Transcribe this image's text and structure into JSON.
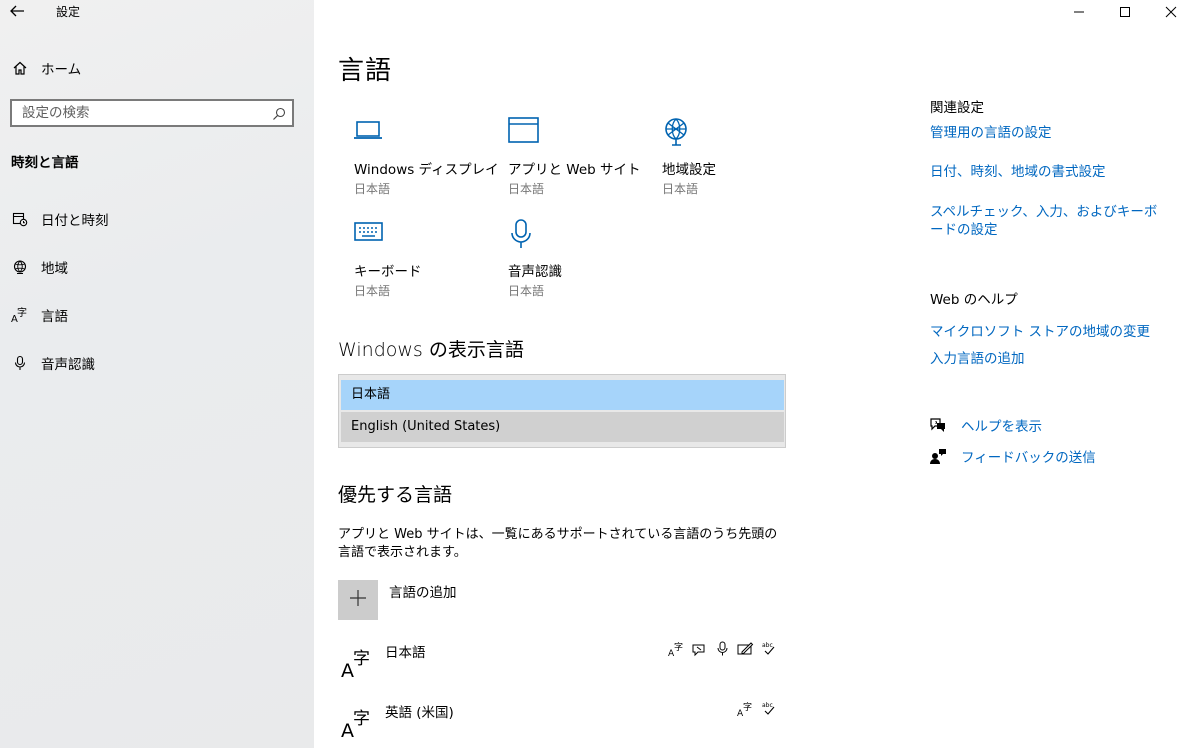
{
  "app": {
    "title": "設定"
  },
  "sidebar": {
    "home_label": "ホーム",
    "search_placeholder": "設定の検索",
    "section_label": "時刻と言語",
    "items": [
      {
        "label": "日付と時刻",
        "icon": "calendar-clock-icon"
      },
      {
        "label": "地域",
        "icon": "globe-icon"
      },
      {
        "label": "言語",
        "icon": "language-icon"
      },
      {
        "label": "音声認識",
        "icon": "microphone-icon"
      }
    ]
  },
  "main": {
    "title": "言語",
    "tiles": [
      {
        "name": "Windows ディスプレイ",
        "sub": "日本語",
        "icon": "laptop-icon"
      },
      {
        "name": "アプリと Web サイト",
        "sub": "日本語",
        "icon": "window-icon"
      },
      {
        "name": "地域設定",
        "sub": "日本語",
        "icon": "globe-icon"
      },
      {
        "name": "キーボード",
        "sub": "日本語",
        "icon": "keyboard-icon"
      },
      {
        "name": "音声認識",
        "sub": "日本語",
        "icon": "microphone-icon"
      }
    ],
    "display_language": {
      "heading": "Windows の表示言語",
      "selected": "日本語",
      "other": "English (United States)"
    },
    "preferred": {
      "heading": "優先する言語",
      "description": "アプリと Web サイトは、一覧にあるサポートされている言語のうち先頭の言語で表示されます。",
      "add_label": "言語の追加",
      "languages": [
        {
          "name": "日本語",
          "features": [
            "display-language-icon",
            "speech-icon",
            "microphone-icon",
            "handwriting-icon",
            "spellcheck-icon"
          ]
        },
        {
          "name": "英語 (米国)",
          "features": [
            "display-language-icon",
            "spellcheck-icon"
          ]
        }
      ]
    }
  },
  "related": {
    "heading": "関連設定",
    "links": [
      "管理用の言語の設定",
      "日付、時刻、地域の書式設定",
      "スペルチェック、入力、およびキーボードの設定"
    ]
  },
  "web_help": {
    "heading": "Web のヘルプ",
    "links": [
      "マイクロソフト ストアの地域の変更",
      "入力言語の追加"
    ]
  },
  "help": {
    "get_help": "ヘルプを表示",
    "feedback": "フィードバックの送信"
  },
  "colors": {
    "accent": "#0067c0",
    "icon_blue": "#0063b1",
    "selected": "#a6d4fa"
  }
}
